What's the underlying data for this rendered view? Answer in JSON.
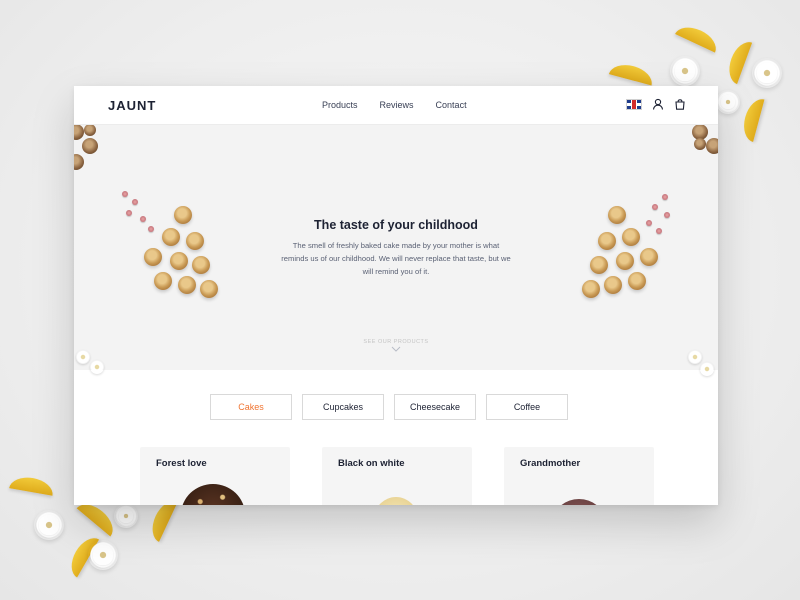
{
  "brand": {
    "logo": "JAUNT"
  },
  "nav": {
    "items": [
      "Products",
      "Reviews",
      "Contact"
    ]
  },
  "header_icons": {
    "flag": "uk-flag-icon",
    "user": "user-icon",
    "cart": "shopping-bag-icon"
  },
  "hero": {
    "title": "The taste of your childhood",
    "text": "The smell of freshly baked cake made by your mother is what reminds us of our childhood. We will never replace that taste, but we will remind you of it.",
    "see_products": "SEE OUR PRODUCTS"
  },
  "tabs": [
    {
      "label": "Cakes",
      "active": true
    },
    {
      "label": "Cupcakes",
      "active": false
    },
    {
      "label": "Cheesecake",
      "active": false
    },
    {
      "label": "Coffee",
      "active": false
    }
  ],
  "products": [
    {
      "title": "Forest love"
    },
    {
      "title": "Black on white"
    },
    {
      "title": "Grandmother"
    }
  ],
  "colors": {
    "accent": "#f07532",
    "text_dark": "#1d2233",
    "hero_bg": "#f3f3f3"
  }
}
